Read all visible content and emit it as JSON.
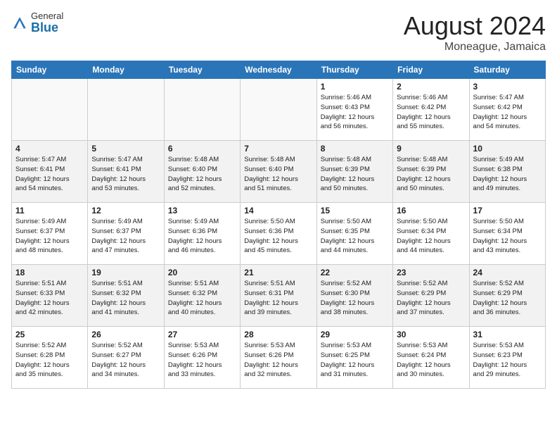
{
  "header": {
    "logo_general": "General",
    "logo_blue": "Blue",
    "month_year": "August 2024",
    "location": "Moneague, Jamaica"
  },
  "days_of_week": [
    "Sunday",
    "Monday",
    "Tuesday",
    "Wednesday",
    "Thursday",
    "Friday",
    "Saturday"
  ],
  "weeks": [
    [
      {
        "day": "",
        "info": ""
      },
      {
        "day": "",
        "info": ""
      },
      {
        "day": "",
        "info": ""
      },
      {
        "day": "",
        "info": ""
      },
      {
        "day": "1",
        "info": "Sunrise: 5:46 AM\nSunset: 6:43 PM\nDaylight: 12 hours\nand 56 minutes."
      },
      {
        "day": "2",
        "info": "Sunrise: 5:46 AM\nSunset: 6:42 PM\nDaylight: 12 hours\nand 55 minutes."
      },
      {
        "day": "3",
        "info": "Sunrise: 5:47 AM\nSunset: 6:42 PM\nDaylight: 12 hours\nand 54 minutes."
      }
    ],
    [
      {
        "day": "4",
        "info": "Sunrise: 5:47 AM\nSunset: 6:41 PM\nDaylight: 12 hours\nand 54 minutes."
      },
      {
        "day": "5",
        "info": "Sunrise: 5:47 AM\nSunset: 6:41 PM\nDaylight: 12 hours\nand 53 minutes."
      },
      {
        "day": "6",
        "info": "Sunrise: 5:48 AM\nSunset: 6:40 PM\nDaylight: 12 hours\nand 52 minutes."
      },
      {
        "day": "7",
        "info": "Sunrise: 5:48 AM\nSunset: 6:40 PM\nDaylight: 12 hours\nand 51 minutes."
      },
      {
        "day": "8",
        "info": "Sunrise: 5:48 AM\nSunset: 6:39 PM\nDaylight: 12 hours\nand 50 minutes."
      },
      {
        "day": "9",
        "info": "Sunrise: 5:48 AM\nSunset: 6:39 PM\nDaylight: 12 hours\nand 50 minutes."
      },
      {
        "day": "10",
        "info": "Sunrise: 5:49 AM\nSunset: 6:38 PM\nDaylight: 12 hours\nand 49 minutes."
      }
    ],
    [
      {
        "day": "11",
        "info": "Sunrise: 5:49 AM\nSunset: 6:37 PM\nDaylight: 12 hours\nand 48 minutes."
      },
      {
        "day": "12",
        "info": "Sunrise: 5:49 AM\nSunset: 6:37 PM\nDaylight: 12 hours\nand 47 minutes."
      },
      {
        "day": "13",
        "info": "Sunrise: 5:49 AM\nSunset: 6:36 PM\nDaylight: 12 hours\nand 46 minutes."
      },
      {
        "day": "14",
        "info": "Sunrise: 5:50 AM\nSunset: 6:36 PM\nDaylight: 12 hours\nand 45 minutes."
      },
      {
        "day": "15",
        "info": "Sunrise: 5:50 AM\nSunset: 6:35 PM\nDaylight: 12 hours\nand 44 minutes."
      },
      {
        "day": "16",
        "info": "Sunrise: 5:50 AM\nSunset: 6:34 PM\nDaylight: 12 hours\nand 44 minutes."
      },
      {
        "day": "17",
        "info": "Sunrise: 5:50 AM\nSunset: 6:34 PM\nDaylight: 12 hours\nand 43 minutes."
      }
    ],
    [
      {
        "day": "18",
        "info": "Sunrise: 5:51 AM\nSunset: 6:33 PM\nDaylight: 12 hours\nand 42 minutes."
      },
      {
        "day": "19",
        "info": "Sunrise: 5:51 AM\nSunset: 6:32 PM\nDaylight: 12 hours\nand 41 minutes."
      },
      {
        "day": "20",
        "info": "Sunrise: 5:51 AM\nSunset: 6:32 PM\nDaylight: 12 hours\nand 40 minutes."
      },
      {
        "day": "21",
        "info": "Sunrise: 5:51 AM\nSunset: 6:31 PM\nDaylight: 12 hours\nand 39 minutes."
      },
      {
        "day": "22",
        "info": "Sunrise: 5:52 AM\nSunset: 6:30 PM\nDaylight: 12 hours\nand 38 minutes."
      },
      {
        "day": "23",
        "info": "Sunrise: 5:52 AM\nSunset: 6:29 PM\nDaylight: 12 hours\nand 37 minutes."
      },
      {
        "day": "24",
        "info": "Sunrise: 5:52 AM\nSunset: 6:29 PM\nDaylight: 12 hours\nand 36 minutes."
      }
    ],
    [
      {
        "day": "25",
        "info": "Sunrise: 5:52 AM\nSunset: 6:28 PM\nDaylight: 12 hours\nand 35 minutes."
      },
      {
        "day": "26",
        "info": "Sunrise: 5:52 AM\nSunset: 6:27 PM\nDaylight: 12 hours\nand 34 minutes."
      },
      {
        "day": "27",
        "info": "Sunrise: 5:53 AM\nSunset: 6:26 PM\nDaylight: 12 hours\nand 33 minutes."
      },
      {
        "day": "28",
        "info": "Sunrise: 5:53 AM\nSunset: 6:26 PM\nDaylight: 12 hours\nand 32 minutes."
      },
      {
        "day": "29",
        "info": "Sunrise: 5:53 AM\nSunset: 6:25 PM\nDaylight: 12 hours\nand 31 minutes."
      },
      {
        "day": "30",
        "info": "Sunrise: 5:53 AM\nSunset: 6:24 PM\nDaylight: 12 hours\nand 30 minutes."
      },
      {
        "day": "31",
        "info": "Sunrise: 5:53 AM\nSunset: 6:23 PM\nDaylight: 12 hours\nand 29 minutes."
      }
    ]
  ]
}
